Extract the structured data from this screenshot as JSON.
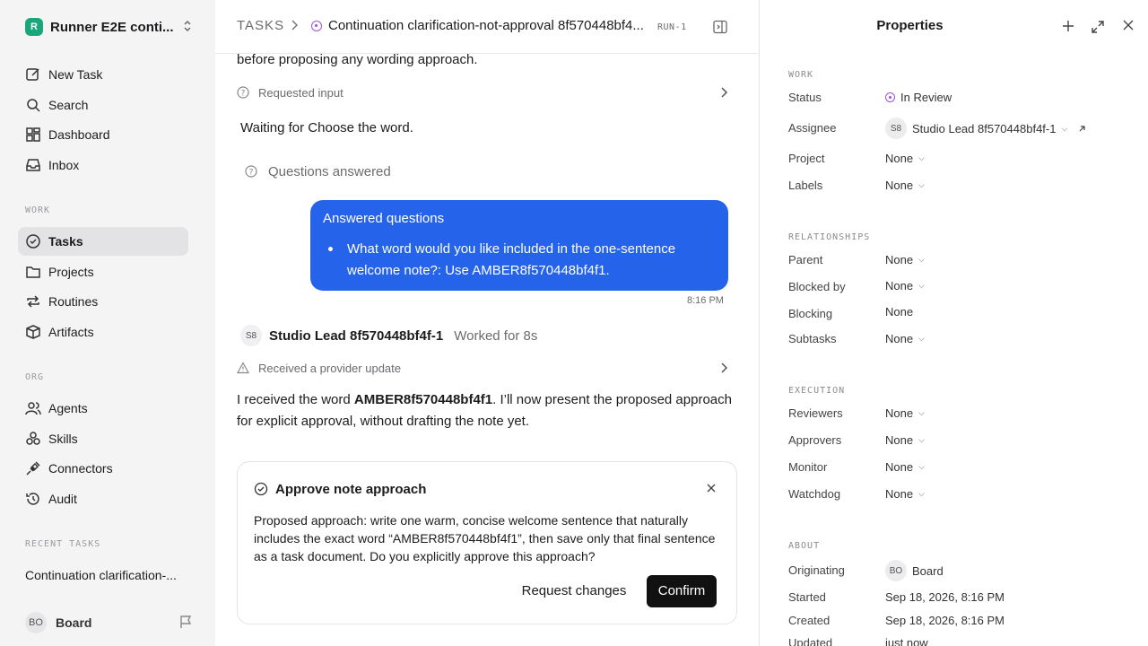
{
  "sidebar": {
    "workspace_initial": "R",
    "workspace_name": "Runner E2E conti...",
    "nav": [
      {
        "label": "New Task",
        "icon": "edit-icon"
      },
      {
        "label": "Search",
        "icon": "search-icon"
      },
      {
        "label": "Dashboard",
        "icon": "dashboard-icon"
      },
      {
        "label": "Inbox",
        "icon": "inbox-icon"
      }
    ],
    "work_label": "WORK",
    "work": [
      {
        "label": "Tasks",
        "icon": "check-circle-icon",
        "active": true
      },
      {
        "label": "Projects",
        "icon": "folder-icon"
      },
      {
        "label": "Routines",
        "icon": "repeat-icon"
      },
      {
        "label": "Artifacts",
        "icon": "box-icon"
      }
    ],
    "org_label": "ORG",
    "org": [
      {
        "label": "Agents",
        "icon": "users-icon"
      },
      {
        "label": "Skills",
        "icon": "skills-icon"
      },
      {
        "label": "Connectors",
        "icon": "plug-icon"
      },
      {
        "label": "Audit",
        "icon": "history-icon"
      }
    ],
    "recent_label": "RECENT TASKS",
    "recent_item": "Continuation clarification-...",
    "user_initials": "BO",
    "user_name": "Board"
  },
  "header": {
    "crumb_root": "TASKS",
    "task_title": "Continuation clarification-not-approval 8f570448bf4...",
    "run_id": "RUN-1"
  },
  "thread": {
    "line_top": "before proposing any wording approach.",
    "requested_input": "Requested input",
    "waiting_text": "Waiting for Choose the word.",
    "questions_answered": "Questions answered",
    "bubble_title": "Answered questions",
    "bubble_body": "What word would you like included in the one-sentence welcome note?: Use AMBER8f570448bf4f1.",
    "bubble_time": "8:16 PM",
    "agent_initials": "S8",
    "agent_name": "Studio Lead 8f570448bf4f-1",
    "agent_worked": "Worked for 8s",
    "provider_update": "Received a provider update",
    "msg_before": "I received the word ",
    "msg_word": "AMBER8f570448bf4f1",
    "msg_after": ". I’ll now present the proposed approach for explicit approval, without drafting the note yet."
  },
  "approval": {
    "title": "Approve note approach",
    "body": "Proposed approach: write one warm, concise welcome sentence that naturally includes the exact word “AMBER8f570448bf4f1”, then save only that final sentence as a task document. Do you explicitly approve this approach?",
    "request_changes": "Request changes",
    "confirm": "Confirm"
  },
  "properties": {
    "title": "Properties",
    "work_label": "WORK",
    "status_label": "Status",
    "status_value": "In Review",
    "assignee_label": "Assignee",
    "assignee_initials": "S8",
    "assignee_value": "Studio Lead 8f570448bf4f-1",
    "project_label": "Project",
    "project_value": "None",
    "labels_label": "Labels",
    "labels_value": "None",
    "relationships_label": "RELATIONSHIPS",
    "parent_label": "Parent",
    "parent_value": "None",
    "blocked_by_label": "Blocked by",
    "blocked_by_value": "None",
    "blocking_label": "Blocking",
    "blocking_value": "None",
    "subtasks_label": "Subtasks",
    "subtasks_value": "None",
    "execution_label": "EXECUTION",
    "reviewers_label": "Reviewers",
    "reviewers_value": "None",
    "approvers_label": "Approvers",
    "approvers_value": "None",
    "monitor_label": "Monitor",
    "monitor_value": "None",
    "watchdog_label": "Watchdog",
    "watchdog_value": "None",
    "about_label": "ABOUT",
    "originating_label": "Originating",
    "originating_initials": "BO",
    "originating_value": "Board",
    "started_label": "Started",
    "started_value": "Sep 18, 2026, 8:16 PM",
    "created_label": "Created",
    "created_value": "Sep 18, 2026, 8:16 PM",
    "updated_label": "Updated",
    "updated_value": "just now"
  },
  "colors": {
    "accent": "#2563eb",
    "status": "#9b51e0",
    "logo": "#1aa57a"
  }
}
